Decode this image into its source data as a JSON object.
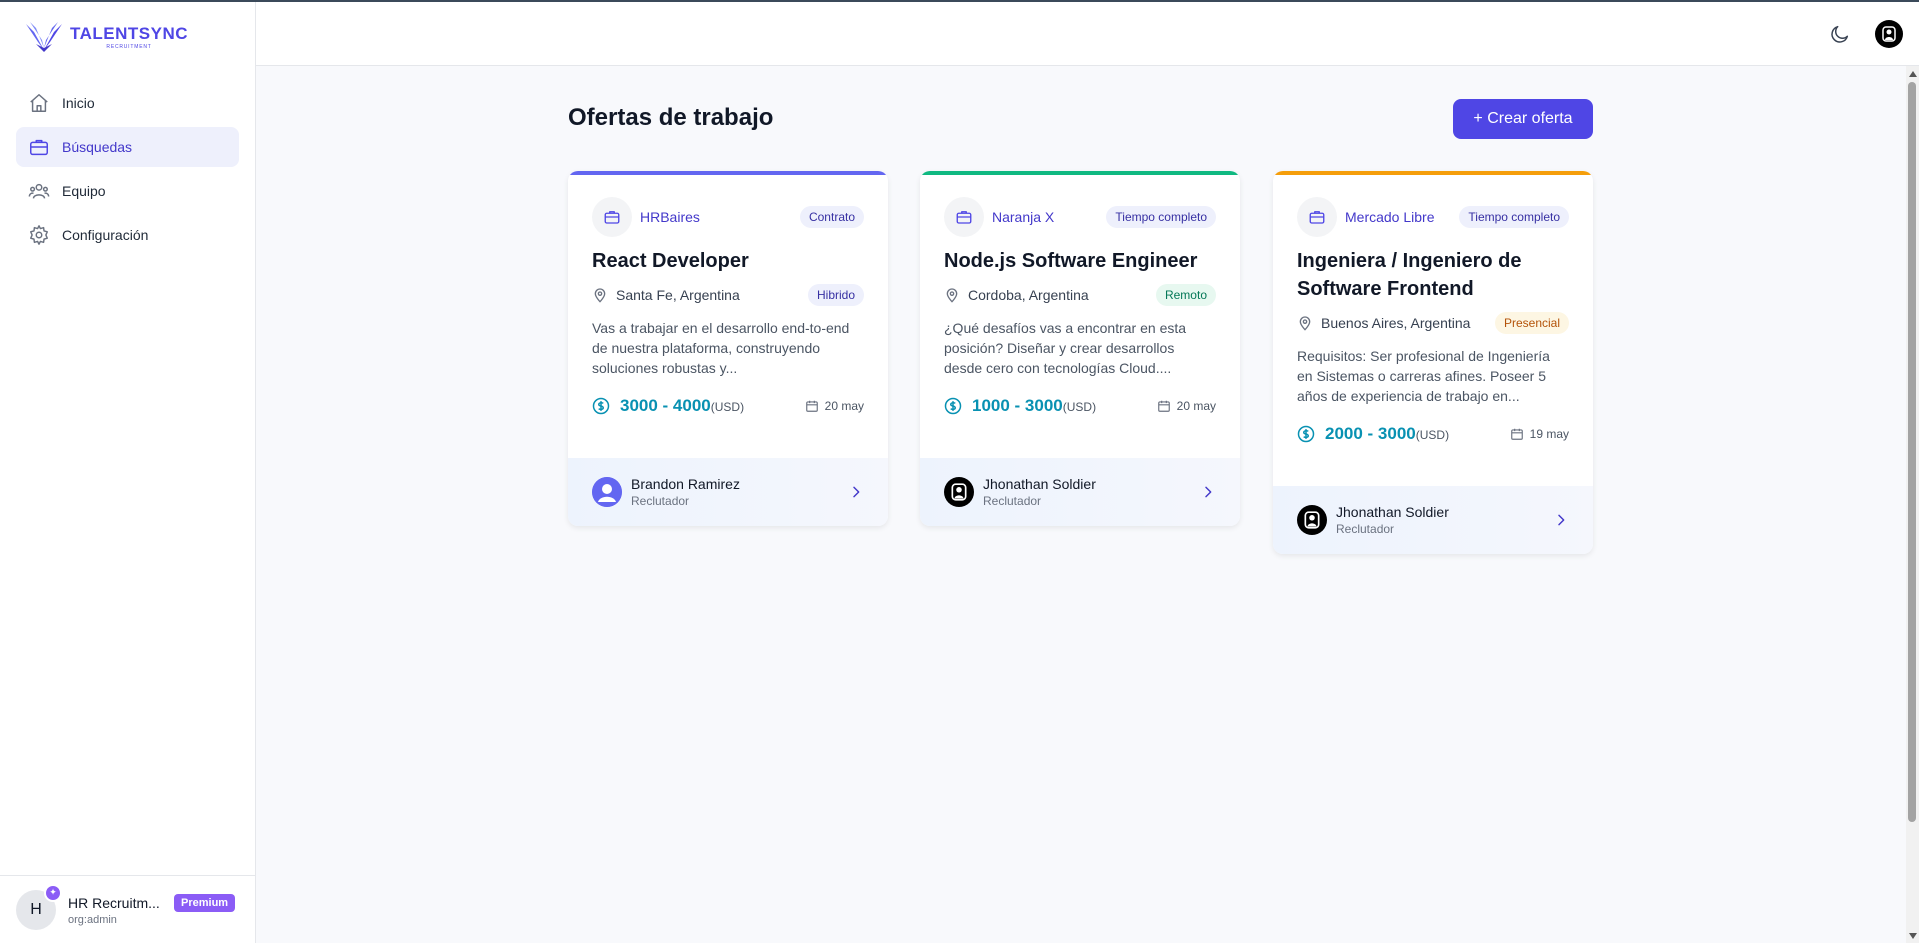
{
  "app": {
    "logo_name": "TALENTSYNC",
    "logo_sub": "RECRUITMENT"
  },
  "sidebar": {
    "items": [
      {
        "label": "Inicio",
        "icon": "home-icon",
        "active": false
      },
      {
        "label": "Búsquedas",
        "icon": "briefcase-icon",
        "active": true
      },
      {
        "label": "Equipo",
        "icon": "users-icon",
        "active": false
      },
      {
        "label": "Configuración",
        "icon": "gear-icon",
        "active": false
      }
    ],
    "user": {
      "initial": "H",
      "name": "HR Recruitm...",
      "badge": "Premium",
      "role": "org:admin"
    }
  },
  "header": {
    "theme_icon": "moon-icon",
    "avatar_icon": "user-avatar-icon"
  },
  "main": {
    "title": "Ofertas de trabajo",
    "create_label": "+ Crear oferta",
    "cards": [
      {
        "accent": "#6366f1",
        "company": "HRBaires",
        "contract": "Contrato",
        "title": "React Developer",
        "location": "Santa Fe, Argentina",
        "mode": "Hibrido",
        "mode_bg": "#eef0fc",
        "mode_color": "#3730a3",
        "description": "Vas a trabajar en el desarrollo end-to-end de nuestra plataforma, construyendo soluciones robustas y...",
        "salary": "3000 - 4000",
        "currency": "(USD)",
        "date": "20 may",
        "recruiter": "Brandon Ramirez",
        "recruiter_role": "Reclutador",
        "recruiter_avatar": "default-user-avatar"
      },
      {
        "accent": "#10b981",
        "company": "Naranja X",
        "contract": "Tiempo completo",
        "title": "Node.js Software Engineer",
        "location": "Cordoba, Argentina",
        "mode": "Remoto",
        "mode_bg": "#e7f8f0",
        "mode_color": "#047857",
        "description": "¿Qué desafíos vas a encontrar en esta posición? Diseñar y crear desarrollos desde cero con tecnologías Cloud....",
        "salary": "1000 - 3000",
        "currency": "(USD)",
        "date": "20 may",
        "recruiter": "Jhonathan Soldier",
        "recruiter_role": "Reclutador",
        "recruiter_avatar": "dark-profile-avatar"
      },
      {
        "accent": "#f59e0b",
        "company": "Mercado Libre",
        "contract": "Tiempo completo",
        "title": "Ingeniera / Ingeniero de Software Frontend",
        "location": "Buenos Aires, Argentina",
        "mode": "Presencial",
        "mode_bg": "#fdf6e3",
        "mode_color": "#b45309",
        "description": "Requisitos: Ser profesional de Ingeniería en Sistemas o carreras afines. Poseer 5 años de experiencia de trabajo en...",
        "salary": "2000 - 3000",
        "currency": "(USD)",
        "date": "19 may",
        "recruiter": "Jhonathan Soldier",
        "recruiter_role": "Reclutador",
        "recruiter_avatar": "dark-profile-avatar"
      }
    ]
  }
}
